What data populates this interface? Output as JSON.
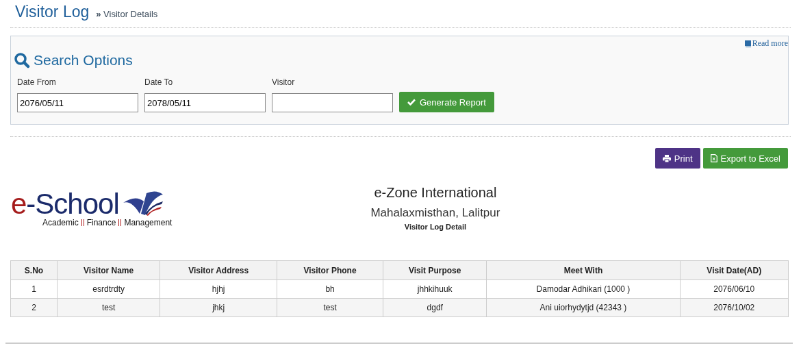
{
  "header": {
    "title": "Visitor Log",
    "breadcrumb_separator": "»",
    "breadcrumb": "Visitor Details"
  },
  "search_panel": {
    "title": "Search Options",
    "read_more": "Read more",
    "fields": [
      {
        "label": "Date From",
        "value": "2076/05/11"
      },
      {
        "label": "Date To",
        "value": "2078/05/11"
      },
      {
        "label": "Visitor"
      }
    ],
    "generate_button": "Generate Report"
  },
  "actions": [
    {
      "kind": "print",
      "label": "Print"
    },
    {
      "kind": "excel",
      "label": "Export to Excel"
    }
  ],
  "report_header": {
    "logo": {
      "prefix": "e",
      "name": "-School",
      "tagline": [
        "Academic",
        "Finance",
        "Management"
      ]
    },
    "organization": "e-Zone International",
    "address": "Mahalaxmisthan, Lalitpur",
    "report_title": "Visitor Log Detail"
  },
  "table": {
    "columns": [
      "S.No",
      "Visitor Name",
      "Visitor Address",
      "Visitor Phone",
      "Visit Purpose",
      "Meet With",
      "Visit Date(AD)"
    ],
    "rows": [
      [
        "1",
        "esrdtrdty",
        "hjhj",
        "bh",
        "jhhkihuuk",
        "Damodar Adhikari (1000 )",
        "2076/06/10"
      ],
      [
        "2",
        "test",
        "jhkj",
        "test",
        "dgdf",
        "Ani uiorhydytjd (42343 )",
        "2076/10/02"
      ]
    ]
  }
}
